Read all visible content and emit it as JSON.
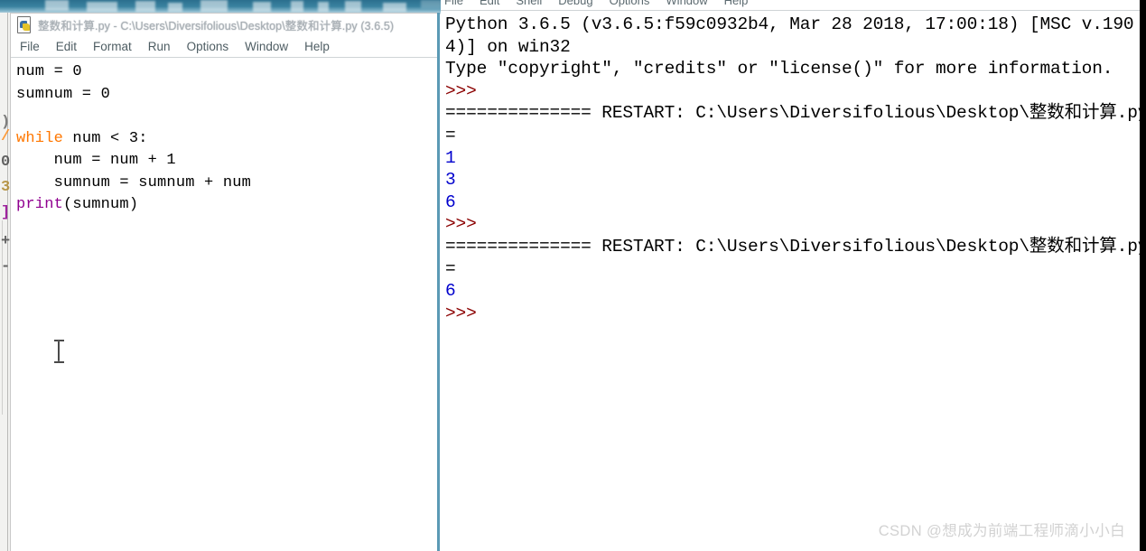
{
  "background": {
    "top_band_color": "#2b6f8e",
    "left_strip_color": "#f2f2f0",
    "right_gutter_color": "#000000"
  },
  "editor": {
    "icon_name": "python-file-icon",
    "title": "整数和计算.py - C:\\Users\\Diversifolious\\Desktop\\整数和计算.py (3.6.5)",
    "menu": [
      {
        "label": "File"
      },
      {
        "label": "Edit"
      },
      {
        "label": "Format"
      },
      {
        "label": "Run"
      },
      {
        "label": "Options"
      },
      {
        "label": "Window"
      },
      {
        "label": "Help"
      }
    ],
    "code_lines": [
      {
        "indent": "",
        "segments": [
          {
            "text": "num = 0",
            "style": "plain"
          }
        ]
      },
      {
        "indent": "",
        "segments": [
          {
            "text": "sumnum = 0",
            "style": "plain"
          }
        ]
      },
      {
        "indent": "",
        "segments": [
          {
            "text": "",
            "style": "plain"
          }
        ]
      },
      {
        "indent": "",
        "segments": [
          {
            "text": "while",
            "style": "keyword"
          },
          {
            "text": " num < 3:",
            "style": "plain"
          }
        ]
      },
      {
        "indent": "    ",
        "segments": [
          {
            "text": "num = num + 1",
            "style": "plain"
          }
        ]
      },
      {
        "indent": "    ",
        "segments": [
          {
            "text": "sumnum = sumnum + num",
            "style": "plain"
          }
        ]
      },
      {
        "indent": "",
        "segments": [
          {
            "text": "print",
            "style": "builtin"
          },
          {
            "text": "(sumnum)",
            "style": "plain"
          }
        ]
      }
    ],
    "code_text": "num = 0\nsumnum = 0\n\nwhile num < 3:\n    num = num + 1\n    sumnum = sumnum + num\nprint(sumnum)",
    "colors": {
      "keyword": "#ff7700",
      "builtin": "#900090",
      "plain": "#000000",
      "background": "#ffffff"
    },
    "cursor_icon": "text-ibeam-cursor"
  },
  "shell": {
    "menu": [
      {
        "label": "File"
      },
      {
        "label": "Edit"
      },
      {
        "label": "Shell"
      },
      {
        "label": "Debug"
      },
      {
        "label": "Options"
      },
      {
        "label": "Window"
      },
      {
        "label": "Help"
      }
    ],
    "colors": {
      "prompt": "#8b0000",
      "output": "#0000cd",
      "text": "#000000",
      "background": "#ffffff"
    },
    "lines": [
      {
        "type": "text",
        "text": "Python 3.6.5 (v3.6.5:f59c0932b4, Mar 28 2018, 17:00:18) [MSC v.190"
      },
      {
        "type": "text",
        "text": "4)] on win32"
      },
      {
        "type": "text",
        "text": "Type \"copyright\", \"credits\" or \"license()\" for more information."
      },
      {
        "type": "prompt",
        "text": ">>>"
      },
      {
        "type": "restart",
        "text": "============== RESTART: C:\\Users\\Diversifolious\\Desktop\\整数和计算.py ="
      },
      {
        "type": "restart",
        "text": "="
      },
      {
        "type": "output",
        "text": "1"
      },
      {
        "type": "output",
        "text": "3"
      },
      {
        "type": "output",
        "text": "6"
      },
      {
        "type": "prompt",
        "text": ">>>"
      },
      {
        "type": "restart",
        "text": "============== RESTART: C:\\Users\\Diversifolious\\Desktop\\整数和计算.py ="
      },
      {
        "type": "restart",
        "text": "="
      },
      {
        "type": "output",
        "text": "6"
      },
      {
        "type": "prompt",
        "text": ">>>"
      }
    ]
  },
  "watermark": {
    "text": "CSDN @想成为前端工程师滴小小白"
  }
}
